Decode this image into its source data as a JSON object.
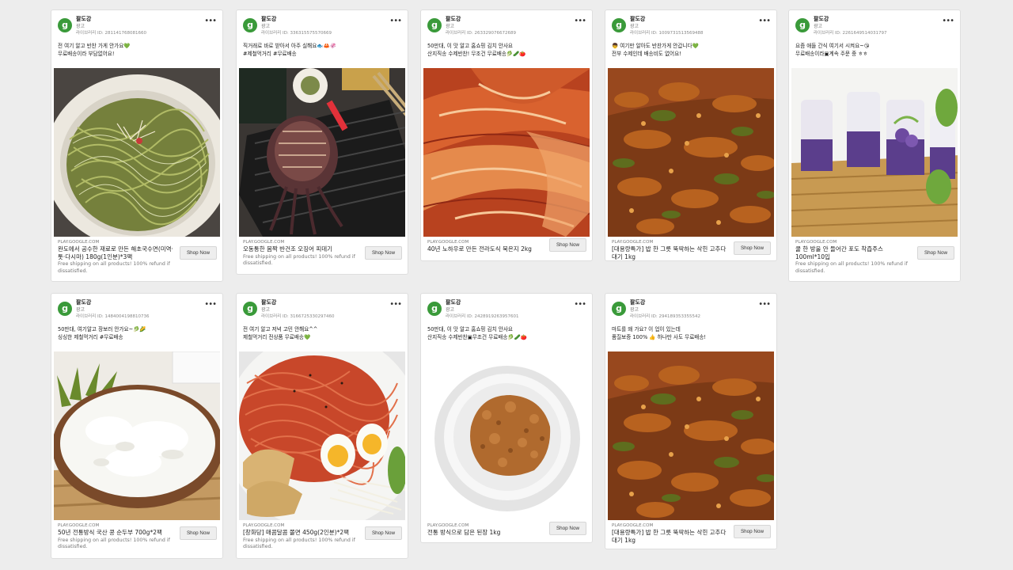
{
  "ads": [
    {
      "page_name": "팔도강",
      "label": "광고",
      "library_id": "라이브러리 ID: 281141768081660",
      "text_line1": "전 여기 알고 반찬 가게 안가요💚",
      "text_line2": "무료배송이라 부담없어요!",
      "domain": "PLAY.GOOGLE.COM",
      "title": "완도에서 공수한 재료로 만든 해초국수면(미역·톳·다시마) 180g(1인분)*3팩",
      "description": "Free shipping on all products! 100% refund if dissatisfied.",
      "cta": "Shop Now",
      "image": "seaweed-noodles"
    },
    {
      "page_name": "팔도강",
      "label": "광고",
      "library_id": "라이브러리 ID: 336315575570669",
      "text_line1": "직거래로 바로 받아서 아주 실해요🐟🦀🦑",
      "text_line2": "#제철먹거리 #무료배송",
      "domain": "PLAY.GOOGLE.COM",
      "title": "오동통한 몸짝 반건조 오징어 피데기",
      "description": "Free shipping on all products! 100% refund if dissatisfied.",
      "cta": "Shop Now",
      "image": "grilled-squid"
    },
    {
      "page_name": "팔도강",
      "label": "광고",
      "library_id": "라이브러리 ID: 263329076672689",
      "text_line1": "50만대, 이 맛 알고 홈쇼핑 김치 안사요",
      "text_line2": "산지직송 수제반찬! 무조건 무료배송🥬🥒🍅",
      "domain": "PLAY.GOOGLE.COM",
      "title": "40년 노하우로 만든 전라도식 묵은지 2kg",
      "description": "",
      "cta": "Shop Now",
      "image": "kimchi"
    },
    {
      "page_name": "팔도강",
      "label": "광고",
      "library_id": "라이브러리 ID: 1009731513569488",
      "text_line1": "👦 여기만 알아도 반찬가게 안갑니다💚",
      "text_line2": "전부 수제인데 배송비도 없어요!",
      "domain": "PLAY.GOOGLE.COM",
      "title": "[대용량특가] 밥 한 그릇 뚝딱하는 삭힌 고추다대기 1kg",
      "description": "",
      "cta": "Shop Now",
      "image": "pepper-relish"
    },
    {
      "page_name": "팔도강",
      "label": "광고",
      "library_id": "라이브러리 ID: 2261649514031797",
      "text_line1": "요즘 애들 간식 여기서 시켜요~😘",
      "text_line2": "무료배송이라▣계속 주문 중 ㅎㅎ",
      "domain": "PLAY.GOOGLE.COM",
      "title": "쿨 한 방울 안 들어간 포도 착즙주스 100ml*10입",
      "description": "Free shipping on all products! 100% refund if dissatisfied.",
      "cta": "Shop Now",
      "image": "grape-juice"
    },
    {
      "page_name": "팔도강",
      "label": "광고",
      "library_id": "라이브러리 ID: 1484004198810736",
      "text_line1": "50만대, 여기알고 장보러 안가요~🥬🌽",
      "text_line2": "싱싱한 제철먹거리 #무료배송",
      "domain": "PLAY.GOOGLE.COM",
      "title": "50년 전통방식 국산 콩 순두부 700g*2팩",
      "description": "Free shipping on all products! 100% refund if dissatisfied.",
      "cta": "Shop Now",
      "image": "soft-tofu"
    },
    {
      "page_name": "팔도강",
      "label": "광고",
      "library_id": "라이브러리 ID: 3166725330297460",
      "text_line1": "전 여기 알고 저녁 고민 안해요^^",
      "text_line2": "제철먹거리 전상품 무료배송💚",
      "domain": "PLAY.GOOGLE.COM",
      "title": "[창화당] 매콤달콤 쫄면 450g(2인분)*2팩",
      "description": "Free shipping on all products! 100% refund if dissatisfied.",
      "cta": "Shop Now",
      "image": "spicy-noodles"
    },
    {
      "page_name": "팔도강",
      "label": "광고",
      "library_id": "라이브러리 ID: 2428919263957601",
      "text_line1": "50만대, 이 맛 알고 홈쇼핑 김치 안사요",
      "text_line2": "산지직송 수제반찬▣무조건 무료배송🥬🥒🍅",
      "domain": "PLAY.GOOGLE.COM",
      "title": "전통 방식으로 담은 된장 1kg",
      "description": "",
      "cta": "Shop Now",
      "image": "doenjang"
    },
    {
      "page_name": "팔도강",
      "label": "광고",
      "library_id": "라이브러리 ID: 294189353355542",
      "text_line1": "마트를 왜 가요? 이 업이 있는데",
      "text_line2": "품질보증 100% 👍 하나만 사도 무료배송!",
      "domain": "PLAY.GOOGLE.COM",
      "title": "[대용량특가] 밥 한 그릇 뚝딱하는 삭힌 고추다대기 1kg",
      "description": "",
      "cta": "Shop Now",
      "image": "pepper-relish"
    }
  ]
}
